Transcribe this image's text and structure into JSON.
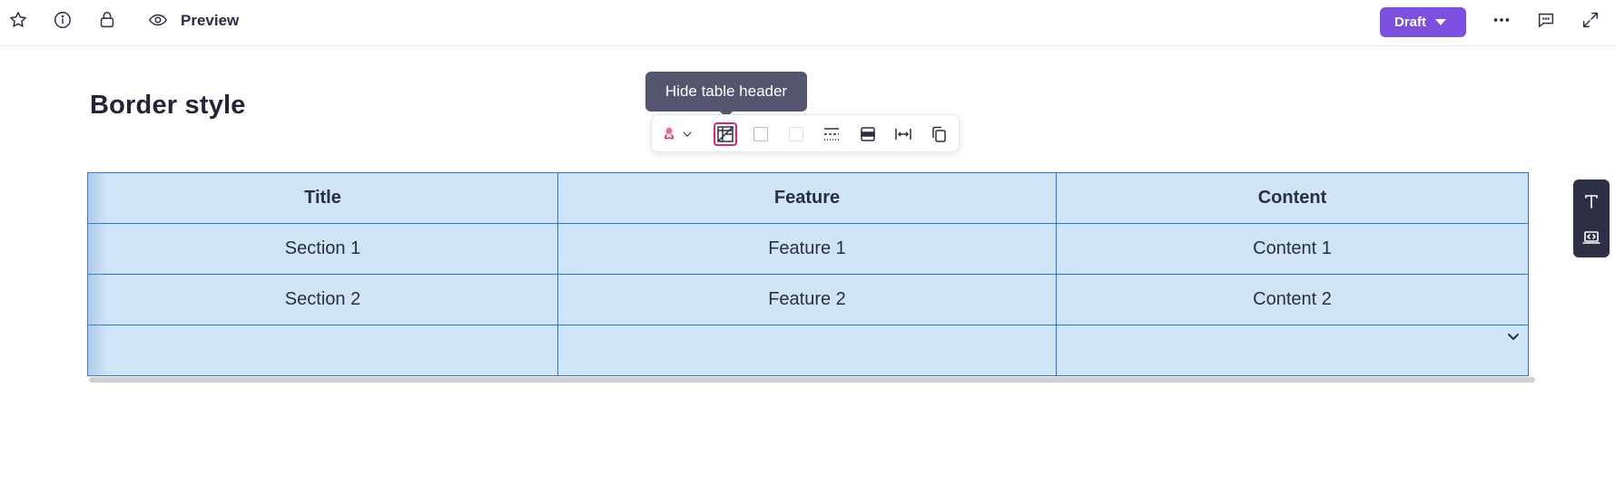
{
  "topbar": {
    "icons": [
      "star-icon",
      "info-icon",
      "lock-icon",
      "eye-icon"
    ],
    "preview_label": "Preview",
    "draft_label": "Draft",
    "right_icons": [
      "more-icon",
      "comment-icon",
      "expand-icon"
    ]
  },
  "page": {
    "title": "Border style"
  },
  "tooltip": {
    "text": "Hide table header"
  },
  "table_toolbar": {
    "buttons": [
      "table-style-icon",
      "hide-header-icon",
      "border-color-box",
      "cell-color-box",
      "border-style-icon",
      "row-toggle-icon",
      "fit-width-icon",
      "duplicate-icon"
    ],
    "accent_color": "#e2246e"
  },
  "table": {
    "headers": [
      "Title",
      "Feature",
      "Content"
    ],
    "rows": [
      [
        "Section 1",
        "Feature 1",
        "Content 1"
      ],
      [
        "Section 2",
        "Feature 2",
        "Content 2"
      ],
      [
        "",
        "",
        ""
      ]
    ],
    "cell_background": "#cfe5f7",
    "border_color": "#2f72d4"
  },
  "side_tools": {
    "buttons": [
      "text-icon",
      "embed-icon"
    ]
  },
  "colors": {
    "brand": "#7b4fe0",
    "tooltip_bg": "#545670"
  }
}
